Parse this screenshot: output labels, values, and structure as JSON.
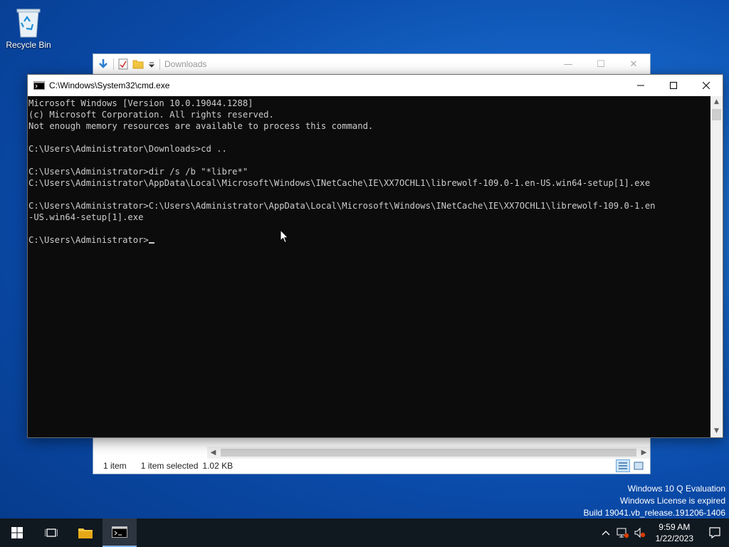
{
  "desktop": {
    "recycle_bin_label": "Recycle Bin"
  },
  "explorer": {
    "title": "Downloads",
    "status_items": "1 item",
    "status_selected": "1 item selected",
    "status_size": "1.02 KB"
  },
  "cmd": {
    "title": "C:\\Windows\\System32\\cmd.exe",
    "output": "Microsoft Windows [Version 10.0.19044.1288]\n(c) Microsoft Corporation. All rights reserved.\nNot enough memory resources are available to process this command.\n\nC:\\Users\\Administrator\\Downloads>cd ..\n\nC:\\Users\\Administrator>dir /s /b \"*libre*\"\nC:\\Users\\Administrator\\AppData\\Local\\Microsoft\\Windows\\INetCache\\IE\\XX7OCHL1\\librewolf-109.0-1.en-US.win64-setup[1].exe\n\nC:\\Users\\Administrator>C:\\Users\\Administrator\\AppData\\Local\\Microsoft\\Windows\\INetCache\\IE\\XX7OCHL1\\librewolf-109.0-1.en\n-US.win64-setup[1].exe\n\n",
    "prompt": "C:\\Users\\Administrator>"
  },
  "watermark": {
    "line1": "Windows 10 Q Evaluation",
    "line2": "Windows License is expired",
    "line3": "Build 19041.vb_release.191206-1406"
  },
  "taskbar": {
    "time": "9:59 AM",
    "date": "1/22/2023"
  },
  "colors": {
    "console_bg": "#0c0c0c",
    "console_text": "#cccccc",
    "taskbar_bg": "#101820",
    "accent": "#0078d7"
  }
}
